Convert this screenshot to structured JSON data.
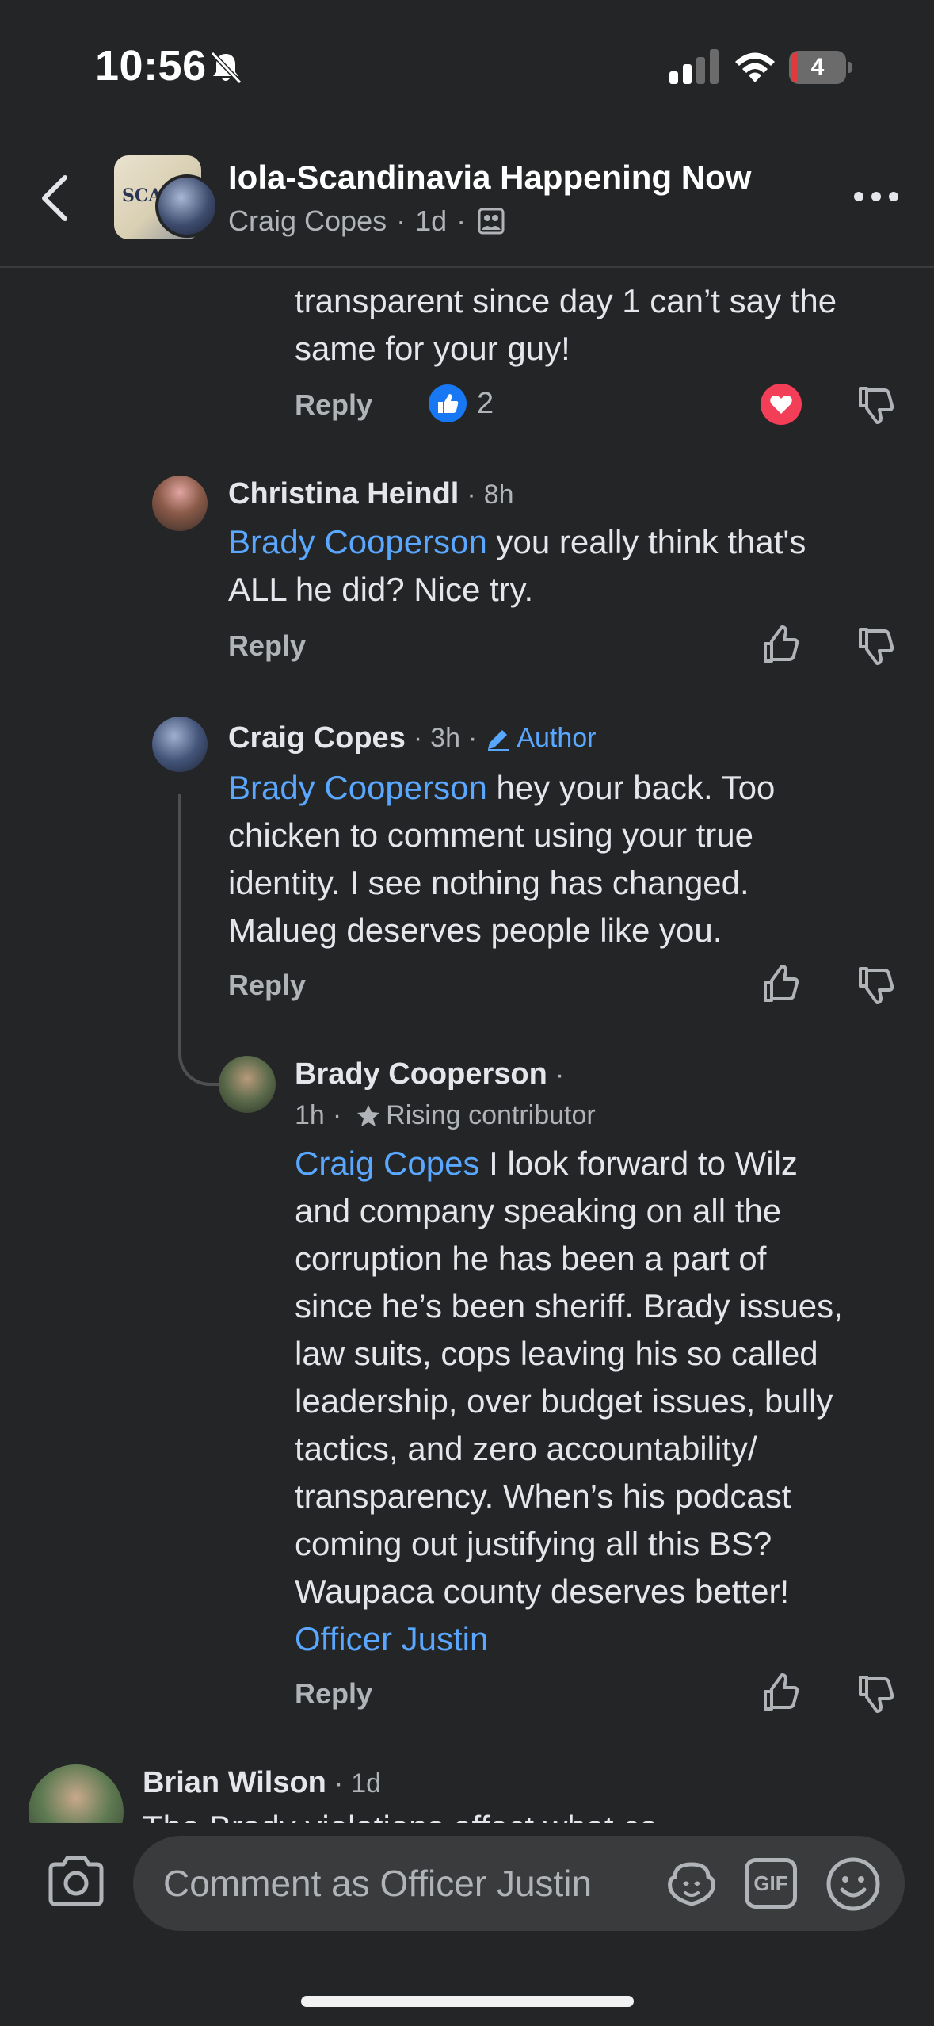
{
  "status_bar": {
    "time": "10:56",
    "battery": "4"
  },
  "header": {
    "title": "Iola-Scandinavia Happening Now",
    "author": "Craig Copes",
    "time": "1d",
    "group_avatar_text": "SCAN"
  },
  "comments": [
    {
      "text": [
        "transparent since day 1 can’t say the",
        "same for your guy!"
      ],
      "reply_label": "Reply",
      "like_count": "2"
    },
    {
      "name": "Christina Heindl",
      "time": "8h",
      "mention": "Brady Cooperson",
      "text": [
        " you really think that's",
        "ALL he did? Nice try."
      ],
      "reply_label": "Reply"
    },
    {
      "name": "Craig Copes",
      "time": "3h",
      "badge": "Author",
      "mention": "Brady Cooperson",
      "text": [
        " hey your back. Too",
        "chicken to comment using your true",
        "identity. I see nothing has changed.",
        "Malueg deserves people like you."
      ],
      "reply_label": "Reply"
    },
    {
      "name": "Brady Cooperson",
      "time": "1h",
      "badge": "Rising contributor",
      "mention": "Craig Copes",
      "text": [
        " I look forward to Wilz",
        "and company speaking on all the",
        "corruption he has been a part of",
        "since he’s been sheriff. Brady issues,",
        "law suits, cops leaving his so called",
        "leadership, over budget issues, bully",
        "tactics, and zero accountability/",
        "transparency. When’s his podcast",
        "coming out justifying all this BS?",
        "Waupaca county deserves better!"
      ],
      "end_mention": "Officer Justin",
      "reply_label": "Reply"
    },
    {
      "name": "Brian Wilson",
      "time": "1d",
      "text": [
        "The Brady violations affect what ca"
      ]
    }
  ],
  "compose": {
    "placeholder": "Comment as Officer Justin",
    "gif_label": "GIF"
  },
  "colors": {
    "background": "#242526",
    "mention": "#5aa7ff",
    "secondary_text": "#b0b3b8",
    "like_blue": "#1877f2",
    "love_red": "#f33e58"
  },
  "icons": [
    "bell-slash-icon",
    "signal-icon",
    "wifi-icon",
    "battery-icon",
    "back-arrow-icon",
    "members-icon",
    "more-icon",
    "like-reaction-icon",
    "love-reaction-icon",
    "thumbs-up-icon",
    "thumbs-down-icon",
    "pencil-icon",
    "star-badge-icon",
    "camera-icon",
    "avatar-sticker-icon",
    "gif-icon",
    "emoji-icon"
  ]
}
